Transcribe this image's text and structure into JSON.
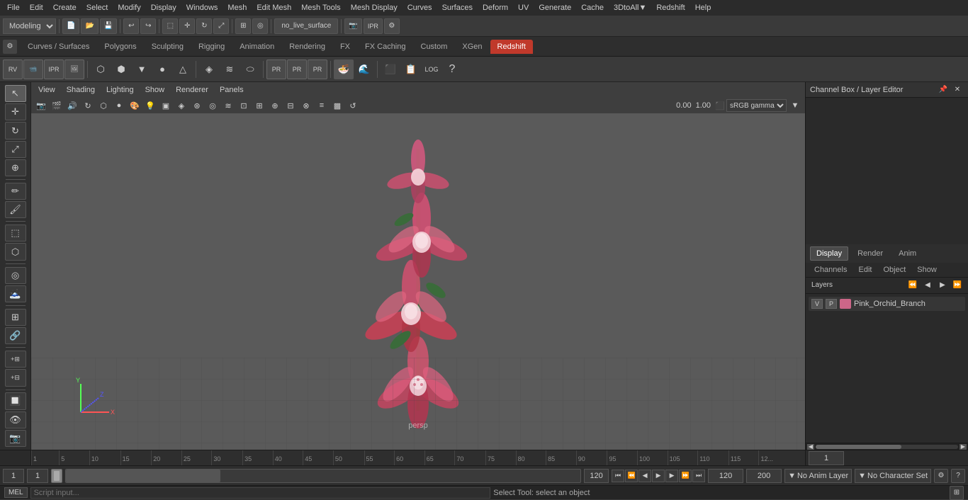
{
  "menubar": {
    "items": [
      "File",
      "Edit",
      "Create",
      "Select",
      "Modify",
      "Display",
      "Windows",
      "Mesh",
      "Edit Mesh",
      "Mesh Tools",
      "Mesh Display",
      "Curves",
      "Surfaces",
      "Deform",
      "UV",
      "Generate",
      "Cache",
      "3DtoAll▼",
      "Redshift",
      "Help"
    ]
  },
  "toolbar1": {
    "workspace_label": "Modeling",
    "buttons": [
      "new",
      "open",
      "save",
      "undo",
      "redo",
      "sep",
      "select_mode",
      "paint_mode",
      "snap_mode",
      "sep",
      "no_live_surface"
    ]
  },
  "tab_bar": {
    "items": [
      "Curves / Surfaces",
      "Polygons",
      "Sculpting",
      "Rigging",
      "Animation",
      "Rendering",
      "FX",
      "FX Caching",
      "Custom",
      "XGen",
      "Redshift"
    ],
    "active": "Redshift"
  },
  "viewport_header": {
    "menus": [
      "View",
      "Shading",
      "Lighting",
      "Show",
      "Renderer",
      "Panels"
    ]
  },
  "viewport": {
    "persp_label": "persp",
    "camera_value": "0.00",
    "zoom_value": "1.00",
    "color_space": "sRGB gamma"
  },
  "left_toolbar": {
    "tools": [
      "select",
      "move",
      "rotate",
      "scale",
      "universal",
      "paint",
      "sep",
      "marquee",
      "lasso",
      "sep",
      "soft_select",
      "sculpt",
      "sep",
      "layout",
      "snap"
    ]
  },
  "right_panel": {
    "title": "Channel Box / Layer Editor",
    "tabs": [
      "Display",
      "Render",
      "Anim"
    ],
    "active_tab": "Display",
    "sub_tabs": [
      "Channels",
      "Edit",
      "Object",
      "Show"
    ],
    "layer_icons": [
      "◀◀",
      "◀",
      "▶",
      "▶▶"
    ],
    "layer": {
      "v_label": "V",
      "p_label": "P",
      "name": "Pink_Orchid_Branch"
    }
  },
  "timeline": {
    "marks": [
      "1",
      "5",
      "10",
      "15",
      "20",
      "25",
      "30",
      "35",
      "40",
      "45",
      "50",
      "55",
      "60",
      "65",
      "70",
      "75",
      "80",
      "85",
      "90",
      "95",
      "100",
      "105",
      "110",
      "115",
      "12..."
    ],
    "mark_positions": [
      0,
      4,
      9,
      14,
      19,
      24,
      29,
      34,
      39,
      44,
      49,
      54,
      59,
      64,
      69,
      74,
      79,
      84,
      89,
      94,
      99,
      104,
      109,
      114,
      119
    ]
  },
  "bottom_controls": {
    "frame_start": "1",
    "frame_current": "1",
    "frame_slider_val": "1",
    "frame_end_display": "120",
    "playback_end": "120",
    "playback_max": "200",
    "anim_layer": "No Anim Layer",
    "char_set": "No Character Set",
    "transport": [
      "⏮",
      "⏪",
      "◀",
      "▶",
      "⏩",
      "⏭"
    ]
  },
  "status_bar": {
    "mel_label": "MEL",
    "status_text": "Select Tool: select an object",
    "script_input": ""
  },
  "layers_label": "Layers",
  "no_char_set": "No Character Set",
  "mesh_display": "Mesh Display",
  "mesh_tools": "Mesh Tools",
  "curves_surfaces": "Curves / Surfaces"
}
